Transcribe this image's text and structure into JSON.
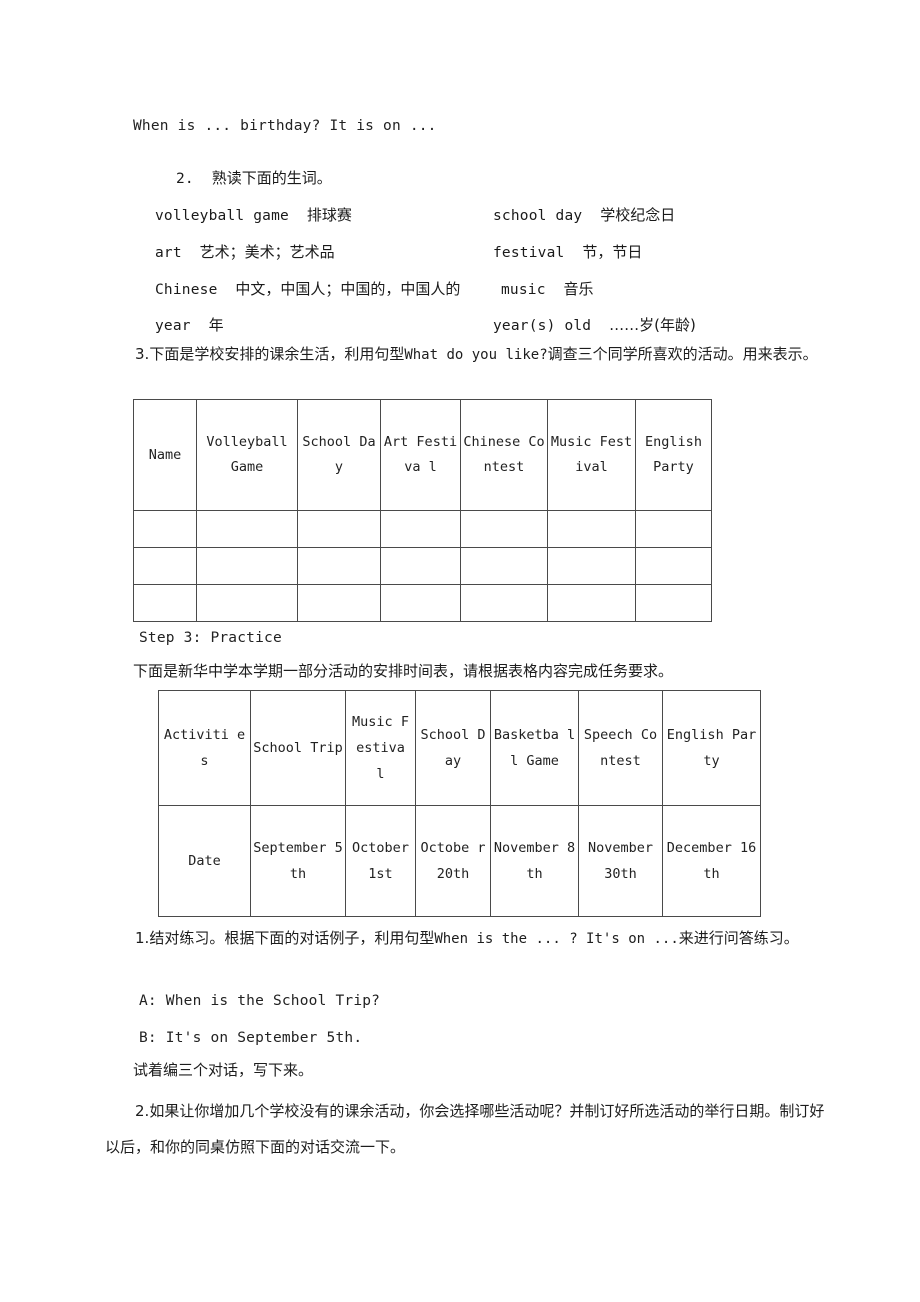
{
  "document": {
    "top_sentence": "When is ... birthday? It is on ...",
    "section_2": {
      "number": "2.",
      "instruction": "熟读下面的生词。",
      "vocabulary": [
        {
          "left_en": "volleyball game",
          "left_cn": "排球赛",
          "right_en": "school day",
          "right_cn": "学校纪念日"
        },
        {
          "left_en": "art",
          "left_cn": "艺术；美术；艺术品",
          "right_en": "festival",
          "right_cn": "节，节日"
        },
        {
          "left_en": "Chinese",
          "left_cn": "中文，中国人；中国的，中国人的",
          "right_en": "music",
          "right_cn": "音乐"
        },
        {
          "left_en": "year",
          "left_cn": "年",
          "right_en": "year(s) old",
          "right_cn": "……岁(年龄)"
        }
      ]
    },
    "section_3": {
      "number": "3.",
      "text_part1": "下面是学校安排的课余生活，利用句型",
      "pattern": "What do you like?",
      "text_part2": "调查三个同学所喜欢的活动。用来表示。"
    },
    "survey_table": {
      "headers": [
        "Name",
        "Volleyball Game",
        "School Day",
        "Art Festiva l",
        "Chinese Contest",
        "Music Festival",
        "English Party"
      ],
      "empty_rows": 3
    },
    "step3": {
      "label": "Step 3: Practice",
      "intro": "下面是新华中学本学期一部分活动的安排时间表，请根据表格内容完成任务要求。"
    },
    "schedule_table": {
      "row_activities": [
        "Activiti es",
        "School Trip",
        "Music Festiva l",
        "School Day",
        "Basketba ll Game",
        "Speech Contest",
        "English Party"
      ],
      "row_dates": [
        "Date",
        "September 5th",
        "October 1st",
        "Octobe r 20th",
        "November 8th",
        "November 30th",
        "December 16th"
      ]
    },
    "task_1": {
      "number": "1.",
      "text_part1": "结对练习。根据下面的对话例子，利用句型",
      "pattern": "When is the ... ? It's on ...",
      "text_part2": "来进行问答练习。",
      "dialogue": [
        "A: When is the School Trip?",
        "B: It's on September 5th."
      ],
      "followup": "试着编三个对话，写下来。"
    },
    "task_2": {
      "number": "2.",
      "text": "如果让你增加几个学校没有的课余活动，你会选择哪些活动呢？并制订好所选活动的举行日期。制订好以后，和你的同桌仿照下面的对话交流一下。"
    }
  }
}
